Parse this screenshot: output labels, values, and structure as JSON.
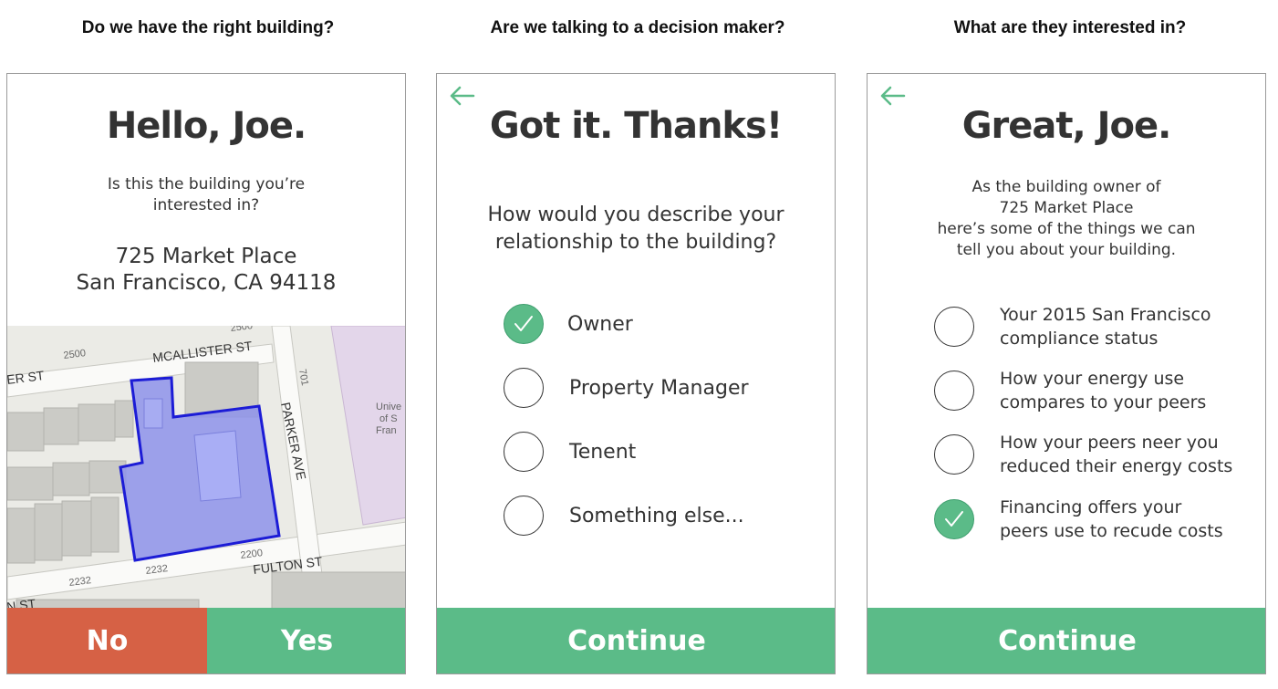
{
  "captions": [
    "Do we have the right building?",
    "Are we talking to a decision maker?",
    "What are they interested in?"
  ],
  "screen1": {
    "heading": "Hello, Joe.",
    "question_line1": "Is this the building you’re",
    "question_line2": "interested in?",
    "address_line1": "725 Market Place",
    "address_line2": "San Francisco, CA 94118",
    "map": {
      "street_mcallister": "MCALLISTER ST",
      "street_parker": "PARKER AVE",
      "street_fulton": "FULTON ST",
      "street_top_left": "ER ST",
      "street_bottom_left": "N ST",
      "num_2500_top": "2500",
      "num_2500": "2500",
      "num_2200": "2200",
      "num_2232": "2232",
      "num_2232b": "2232",
      "num_701": "701",
      "univ_1": "Unive",
      "univ_2": "of S",
      "univ_3": "Fran"
    },
    "no_label": "No",
    "yes_label": "Yes",
    "colors": {
      "no": "#d66145",
      "yes": "#5bbb88"
    }
  },
  "screen2": {
    "heading": "Got it. Thanks!",
    "question_line1": "How would you describe your",
    "question_line2": "relationship to the building?",
    "options": [
      {
        "label": "Owner",
        "checked": true
      },
      {
        "label": "Property Manager",
        "checked": false
      },
      {
        "label": "Tenent",
        "checked": false
      },
      {
        "label": "Something else...",
        "checked": false
      }
    ],
    "continue_label": "Continue"
  },
  "screen3": {
    "heading": "Great, Joe.",
    "intro_line1": "As the building owner of",
    "intro_line2": "725 Market Place",
    "intro_line3": "here’s some of the things we can",
    "intro_line4": "tell you about your building.",
    "options": [
      {
        "line1": "Your 2015 San Francisco",
        "line2": "compliance status",
        "checked": false
      },
      {
        "line1": "How your energy use",
        "line2": "compares to your peers",
        "checked": false
      },
      {
        "line1": "How your peers neer you",
        "line2": "reduced their energy costs",
        "checked": false
      },
      {
        "line1": "Financing offers your",
        "line2": "peers use to recude costs",
        "checked": true
      }
    ],
    "continue_label": "Continue"
  },
  "icons": {
    "back": "arrow-left-icon",
    "check": "checkmark-icon"
  },
  "accent_color": "#5bbb88"
}
